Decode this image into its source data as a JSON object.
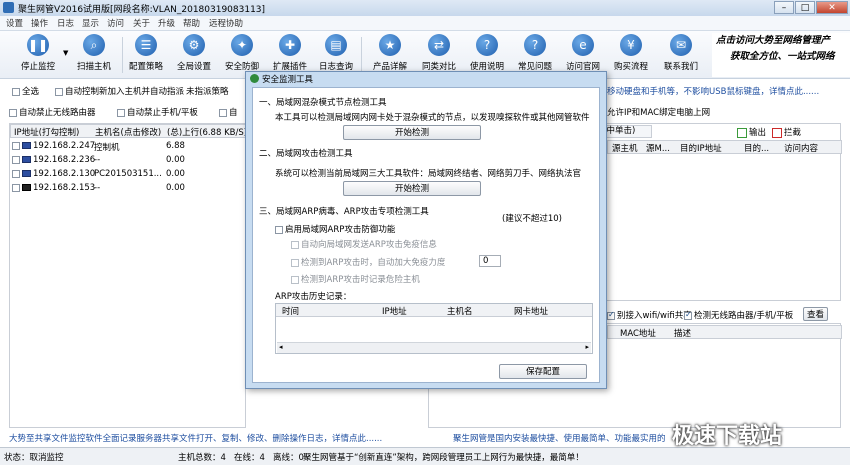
{
  "window": {
    "title": "聚生网管V2016试用版[网段名称:VLAN_20180319083113]",
    "min": "–",
    "max": "□",
    "close": "✕"
  },
  "menu": [
    "设置",
    "操作",
    "日志",
    "显示",
    "访问",
    "关于",
    "升级",
    "帮助",
    "远程协助"
  ],
  "toolbar": {
    "left": [
      {
        "label": "停止监控",
        "icon": "pause-icon",
        "glyph": "❚❚"
      },
      {
        "label": "扫描主机",
        "icon": "scan-icon",
        "glyph": "⌕"
      }
    ],
    "mid": [
      {
        "label": "配置策略",
        "icon": "policy-icon",
        "glyph": "☰"
      },
      {
        "label": "全局设置",
        "icon": "global-settings-icon",
        "glyph": "⚙"
      },
      {
        "label": "安全防御",
        "icon": "security-icon",
        "glyph": "✦"
      },
      {
        "label": "扩展插件",
        "icon": "plugin-icon",
        "glyph": "✚"
      },
      {
        "label": "日志查询",
        "icon": "log-icon",
        "glyph": "▤"
      }
    ],
    "right": [
      {
        "label": "产品详解",
        "icon": "product-icon",
        "glyph": "★"
      },
      {
        "label": "同类对比",
        "icon": "compare-icon",
        "glyph": "⇄"
      },
      {
        "label": "使用说明",
        "icon": "help-icon",
        "glyph": "?"
      },
      {
        "label": "常见问题",
        "icon": "faq-icon",
        "glyph": "?"
      },
      {
        "label": "访问官网",
        "icon": "website-icon",
        "glyph": "e"
      },
      {
        "label": "购买流程",
        "icon": "purchase-icon",
        "glyph": "¥"
      },
      {
        "label": "联系我们",
        "icon": "contact-icon",
        "glyph": "✉"
      }
    ],
    "banner_line1": "点击访问大势至网络管理产",
    "banner_line2": "获取全方位、一站式网络"
  },
  "options": {
    "row1": [
      "全选",
      "自动控制新加入主机并自动指派",
      "未指派策略"
    ],
    "row2": [
      "自动禁止无线路由器",
      "自动禁止手机/平板",
      "自"
    ],
    "right_notice": "移动硬盘和手机等，不影响USB鼠标键盘，详情点此......",
    "right_notice2": "允许IP和MAC绑定电脑上网"
  },
  "hosts": {
    "headers": [
      "IP地址(打勾控制)",
      "主机名(点击修改)",
      "(总)上行(6.88 KB/S)"
    ],
    "rows": [
      {
        "ip": "192.168.2.247",
        "name": "控制机",
        "up": "6.88"
      },
      {
        "ip": "192.168.2.236",
        "name": "--",
        "up": "0.00"
      },
      {
        "ip": "192.168.2.130",
        "name": "PC201503151...",
        "up": "0.00"
      },
      {
        "ip": "192.168.2.153",
        "name": "--",
        "up": "0.00"
      }
    ]
  },
  "right_panel": {
    "tab": "选中单击)",
    "legend_out": "输出",
    "legend_block": "拦截",
    "headers": [
      "源主机",
      "源M...",
      "目的IP地址",
      "目的...",
      "访问内容"
    ],
    "wifi_label": "别接入wifi/wifi共享",
    "wifi_check": "检测无线路由器/手机/平板",
    "view_btn": "查看",
    "lower_headers": [
      "MAC地址",
      "描述"
    ]
  },
  "dialog": {
    "title": "安全监测工具",
    "s1_title": "一、局域网混杂模式节点检测工具",
    "s1_desc": "本工具可以检测局域网内网卡处于混杂模式的节点，以发现嗅探软件或其他网管软件",
    "s1_btn": "开始检测",
    "s2_title": "二、局域网攻击检测工具",
    "s2_desc": "系统可以检测当前局域网三大工具软件：局域网终结者、网络剪刀手、网络执法官",
    "s2_btn": "开始检测",
    "s3_title": "三、局域网ARP病毒、ARP攻击专项检测工具",
    "s3_hint": "(建议不超过10)",
    "opt_enable": "启用局域网ARP攻击防御功能",
    "opt1": "自动向局域网发送ARP攻击免疫信息",
    "opt2": "检测到ARP攻击时，自动加大免疫力度",
    "opt2_value": "0",
    "opt3": "检测到ARP攻击时记录危险主机",
    "log_label": "ARP攻击历史记录：",
    "log_headers": [
      "时间",
      "IP地址",
      "主机名",
      "网卡地址"
    ],
    "save_btn": "保存配置"
  },
  "bottom": {
    "left_ad": "大势至共享文件监控软件全面记录服务器共享文件打开、复制、修改、删除操作日志，详情点此......",
    "right_ad": "聚生网管是国内安装最快捷、使用最简单、功能最实用的",
    "status_left": "状态：取消监控",
    "status_mid": "主机总数：4   在线：4   离线：0",
    "status_right": "聚生网管基于“创新直连”架构，跨网段管理员工上网行为最快捷，最简单！"
  },
  "watermark": "极速下载站",
  "colors": {
    "accent": "#1f5fae",
    "dialog_frame": "#c7dcf1",
    "legend_out": "#3a9a3a",
    "legend_block": "#cc2a2a"
  }
}
